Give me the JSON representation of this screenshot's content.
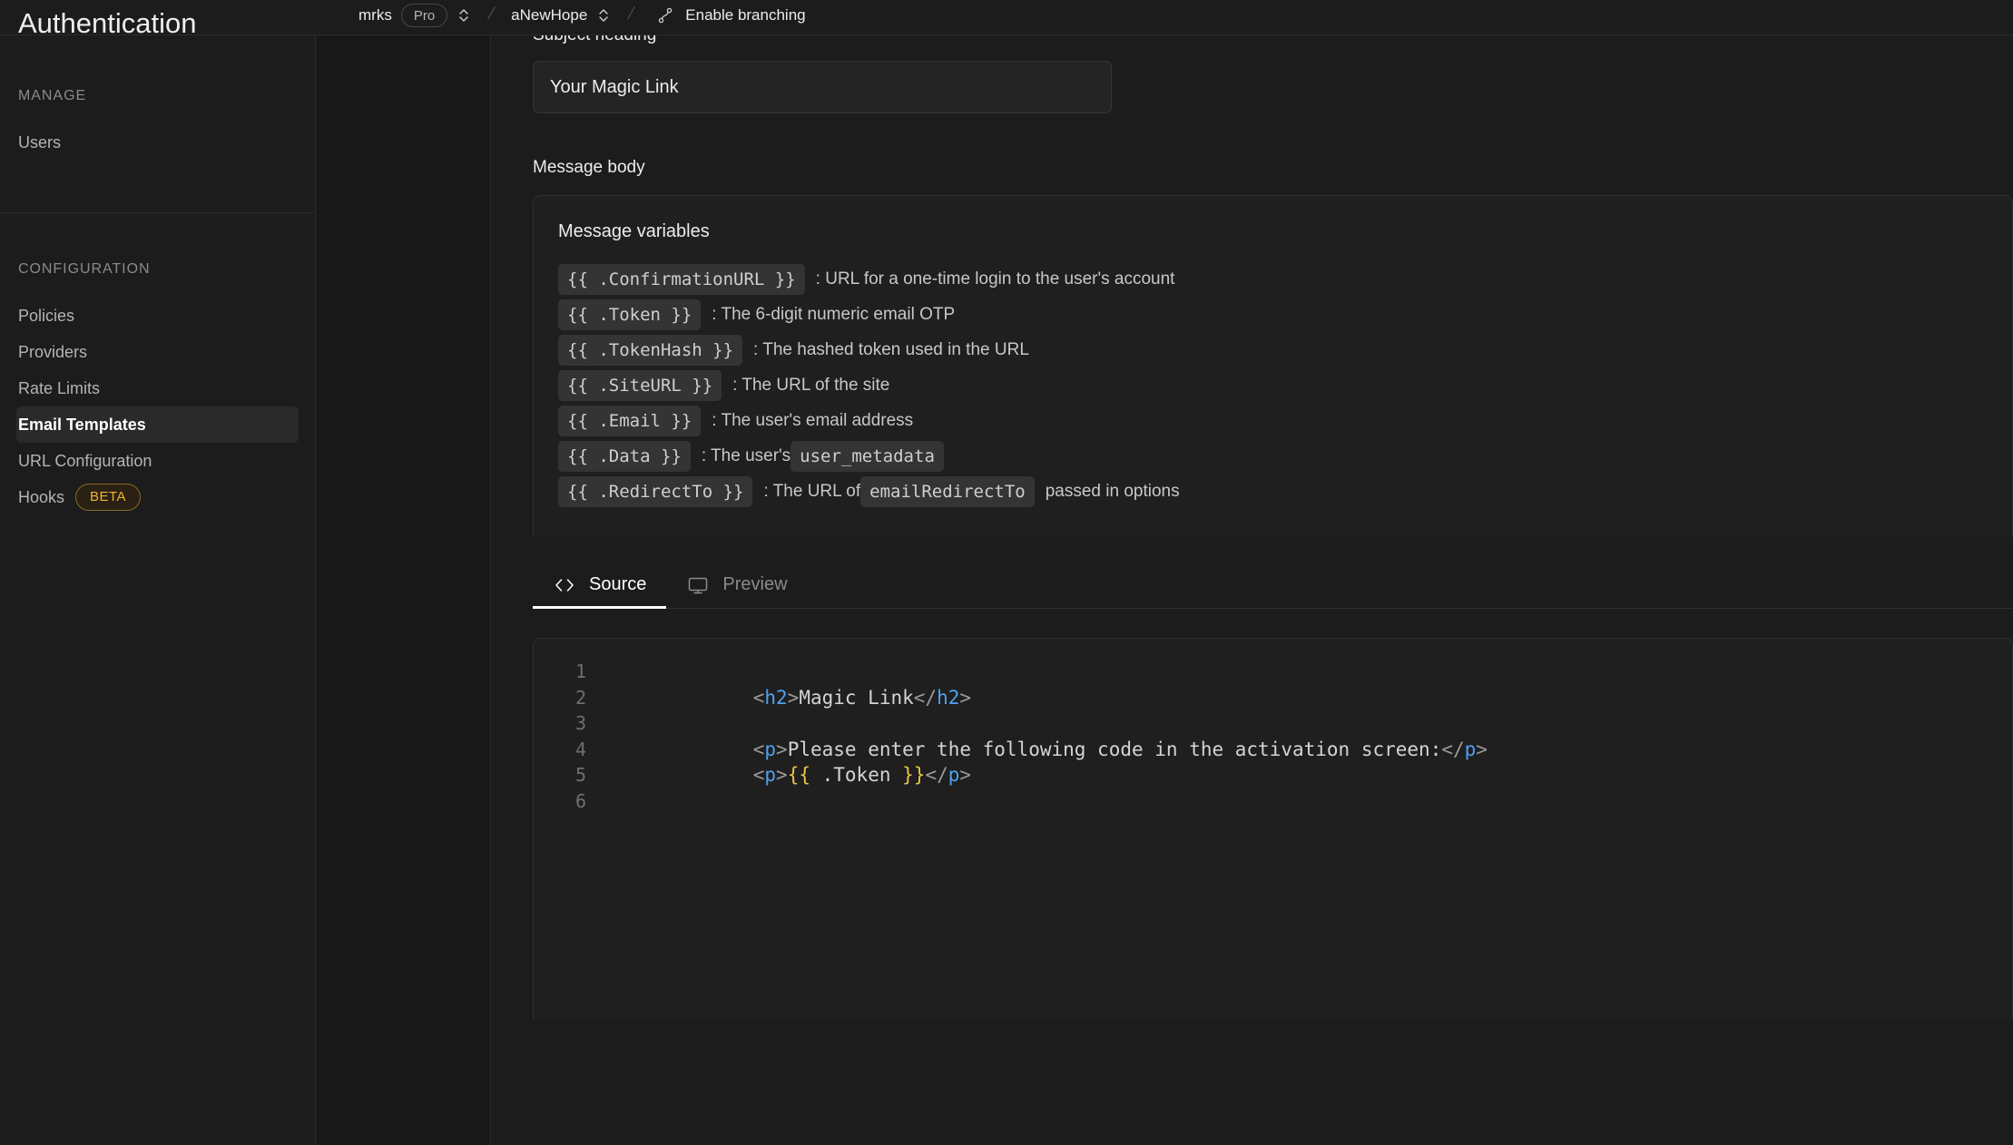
{
  "header": {
    "page_title": "Authentication",
    "org": "mrks",
    "plan_badge": "Pro",
    "project": "aNewHope",
    "separator": "/",
    "branching_label": "Enable branching"
  },
  "sidebar": {
    "sections": [
      {
        "heading": "MANAGE",
        "items": [
          {
            "label": "Users",
            "active": false,
            "badge": null
          }
        ]
      },
      {
        "heading": "CONFIGURATION",
        "items": [
          {
            "label": "Policies",
            "active": false,
            "badge": null
          },
          {
            "label": "Providers",
            "active": false,
            "badge": null
          },
          {
            "label": "Rate Limits",
            "active": false,
            "badge": null
          },
          {
            "label": "Email Templates",
            "active": true,
            "badge": null
          },
          {
            "label": "URL Configuration",
            "active": false,
            "badge": null
          },
          {
            "label": "Hooks",
            "active": false,
            "badge": "BETA"
          }
        ]
      }
    ]
  },
  "main": {
    "subject_label": "Subject heading",
    "subject_value": "Your Magic Link",
    "message_body_label": "Message body",
    "variables_title": "Message variables",
    "variables": [
      {
        "token": "{{ .ConfirmationURL }}",
        "desc_prefix": ": URL for a one-time login to the user's account",
        "inline_code": null,
        "desc_suffix": null
      },
      {
        "token": "{{ .Token }}",
        "desc_prefix": ": The 6-digit numeric email OTP",
        "inline_code": null,
        "desc_suffix": null
      },
      {
        "token": "{{ .TokenHash }}",
        "desc_prefix": ": The hashed token used in the URL",
        "inline_code": null,
        "desc_suffix": null
      },
      {
        "token": "{{ .SiteURL }}",
        "desc_prefix": ": The URL of the site",
        "inline_code": null,
        "desc_suffix": null
      },
      {
        "token": "{{ .Email }}",
        "desc_prefix": ": The user's email address",
        "inline_code": null,
        "desc_suffix": null
      },
      {
        "token": "{{ .Data }}",
        "desc_prefix": ": The user's",
        "inline_code": "user_metadata",
        "desc_suffix": null
      },
      {
        "token": "{{ .RedirectTo }}",
        "desc_prefix": ": The URL of",
        "inline_code": "emailRedirectTo",
        "desc_suffix": "passed in options"
      }
    ],
    "tabs": [
      {
        "label": "Source",
        "icon": "code-brackets-icon",
        "active": true
      },
      {
        "label": "Preview",
        "icon": "monitor-icon",
        "active": false
      }
    ],
    "editor": {
      "line_numbers": [
        "1",
        "2",
        "3",
        "4",
        "5",
        "6"
      ],
      "lines": [
        {
          "n": "1",
          "segments": []
        },
        {
          "n": "2",
          "segments": [
            {
              "t": "<",
              "c": "punct"
            },
            {
              "t": "h2",
              "c": "tag"
            },
            {
              "t": ">",
              "c": "punct"
            },
            {
              "t": "Magic Link",
              "c": "txt"
            },
            {
              "t": "</",
              "c": "punct"
            },
            {
              "t": "h2",
              "c": "tag"
            },
            {
              "t": ">",
              "c": "punct"
            }
          ]
        },
        {
          "n": "3",
          "segments": []
        },
        {
          "n": "4",
          "segments": [
            {
              "t": "<",
              "c": "punct"
            },
            {
              "t": "p",
              "c": "tag"
            },
            {
              "t": ">",
              "c": "punct"
            },
            {
              "t": "Please enter the following code in the activation screen:",
              "c": "txt"
            },
            {
              "t": "</",
              "c": "punct"
            },
            {
              "t": "p",
              "c": "tag"
            },
            {
              "t": ">",
              "c": "punct"
            }
          ]
        },
        {
          "n": "5",
          "segments": [
            {
              "t": "<",
              "c": "punct"
            },
            {
              "t": "p",
              "c": "tag"
            },
            {
              "t": ">",
              "c": "punct"
            },
            {
              "t": "{{",
              "c": "brace"
            },
            {
              "t": " .Token ",
              "c": "txt"
            },
            {
              "t": "}}",
              "c": "brace"
            },
            {
              "t": "</",
              "c": "punct"
            },
            {
              "t": "p",
              "c": "tag"
            },
            {
              "t": ">",
              "c": "punct"
            }
          ]
        },
        {
          "n": "6",
          "segments": []
        }
      ]
    }
  },
  "colors": {
    "background": "#1c1c1c",
    "panel": "#1f1f1f",
    "subnav": "#181818",
    "border": "#2b2b2b",
    "accent_beta": "#f0b429",
    "tag_blue": "#4ea1f3",
    "brace_yellow": "#e8c547",
    "text_primary": "#ededed",
    "text_muted": "#8a8a8a"
  }
}
